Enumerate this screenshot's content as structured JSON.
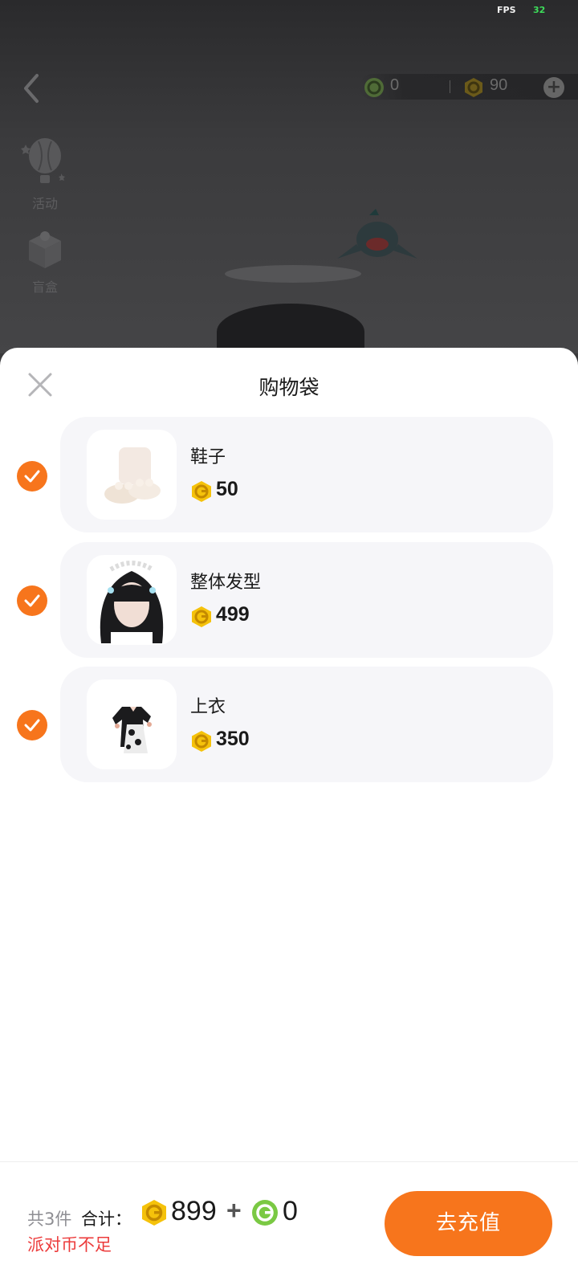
{
  "status": {
    "fps_label": "FPS",
    "fps_value": "32"
  },
  "top_bar": {
    "back_icon": "chevron-left-icon",
    "green_currency": {
      "icon": "green-coin-icon",
      "value": "0"
    },
    "gold_currency": {
      "icon": "gold-coin-icon",
      "value": "90"
    },
    "add_icon": "plus-icon"
  },
  "side_menu": [
    {
      "icon": "hot-air-balloon-icon",
      "label": "活动"
    },
    {
      "icon": "gift-box-icon",
      "label": "盲盒"
    }
  ],
  "sheet": {
    "title": "购物袋",
    "close_icon": "close-icon",
    "items": [
      {
        "name": "鞋子",
        "price": "50",
        "checked": true,
        "thumb": "slippers-thumbnail"
      },
      {
        "name": "整体发型",
        "price": "499",
        "checked": true,
        "thumb": "hairstyle-thumbnail"
      },
      {
        "name": "上衣",
        "price": "350",
        "checked": true,
        "thumb": "top-thumbnail"
      }
    ]
  },
  "footer": {
    "count_text": "共3件",
    "total_label": "合计：",
    "gold_total": "899",
    "plus": "+",
    "green_total": "0",
    "warning": "派对币不足",
    "recharge_button": "去充值"
  },
  "colors": {
    "accent": "#f7751c",
    "warning": "#ec3b3b",
    "gold": "#f5c20b",
    "green": "#7ac943",
    "card_bg": "#f6f6f9"
  }
}
